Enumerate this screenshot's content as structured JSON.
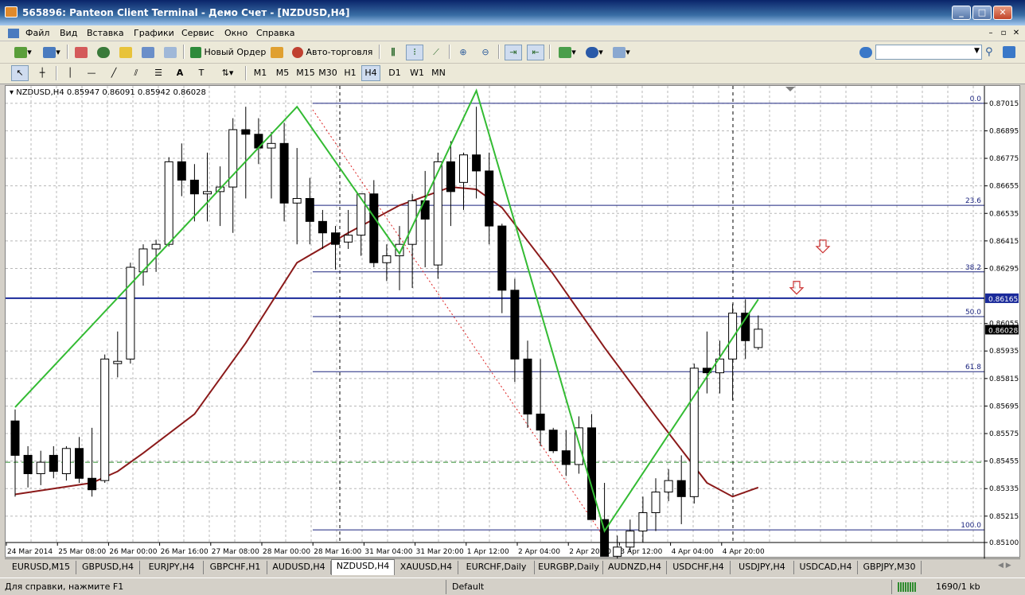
{
  "window": {
    "title": "565896: Panteon Client Terminal - Демо Счет - [NZDUSD,H4]"
  },
  "menu": [
    "Файл",
    "Вид",
    "Вставка",
    "Графики",
    "Сервис",
    "Окно",
    "Справка"
  ],
  "toolbar": {
    "new_order": "Новый Ордер",
    "autotrade": "Авто-торговля"
  },
  "timeframes": [
    "M1",
    "M5",
    "M15",
    "M30",
    "H1",
    "H4",
    "D1",
    "W1",
    "MN"
  ],
  "active_timeframe": "H4",
  "chart": {
    "symbol_info": "NZDUSD,H4  0.85947 0.86091 0.85942 0.86028",
    "price_labels": [
      "0.87015",
      "0.86895",
      "0.86775",
      "0.86655",
      "0.86535",
      "0.86415",
      "0.86295",
      "0.86055",
      "0.85935",
      "0.85815",
      "0.85695",
      "0.85575",
      "0.85455",
      "0.85335",
      "0.85215",
      "0.85100"
    ],
    "current_line": "0.86165",
    "bid_price": "0.86028",
    "fib_levels": [
      {
        "label": "0.0",
        "price": 0.87015
      },
      {
        "label": "23.6",
        "price": 0.8657
      },
      {
        "label": "38.2",
        "price": 0.8628
      },
      {
        "label": "50.0",
        "price": 0.86085
      },
      {
        "label": "61.8",
        "price": 0.85845
      },
      {
        "label": "100.0",
        "price": 0.85155
      }
    ],
    "time_labels": [
      "24 Mar 2014",
      "25 Mar 08:00",
      "26 Mar 00:00",
      "26 Mar 16:00",
      "27 Mar 08:00",
      "28 Mar 00:00",
      "28 Mar 16:00",
      "31 Mar 04:00",
      "31 Mar 20:00",
      "1 Apr 12:00",
      "2 Apr 04:00",
      "2 Apr 20:00",
      "3 Apr 12:00",
      "4 Apr 04:00",
      "4 Apr 20:00"
    ],
    "colors": {
      "ma": "#8b1a1a",
      "zigzag": "#33bb33",
      "levels": "#1a237e",
      "arrow": "#cc3333"
    }
  },
  "chart_data": {
    "type": "candlestick",
    "ylim": [
      0.851,
      0.8707
    ],
    "candles": [
      {
        "o": 0.8563,
        "h": 0.8568,
        "l": 0.853,
        "c": 0.8548
      },
      {
        "o": 0.8548,
        "h": 0.8552,
        "l": 0.8534,
        "c": 0.854
      },
      {
        "o": 0.854,
        "h": 0.855,
        "l": 0.8535,
        "c": 0.8545
      },
      {
        "o": 0.8548,
        "h": 0.8552,
        "l": 0.8538,
        "c": 0.8541
      },
      {
        "o": 0.854,
        "h": 0.8552,
        "l": 0.8537,
        "c": 0.8551
      },
      {
        "o": 0.8551,
        "h": 0.8556,
        "l": 0.8536,
        "c": 0.8538
      },
      {
        "o": 0.8538,
        "h": 0.856,
        "l": 0.853,
        "c": 0.8533
      },
      {
        "o": 0.8537,
        "h": 0.8592,
        "l": 0.8536,
        "c": 0.859
      },
      {
        "o": 0.8588,
        "h": 0.8602,
        "l": 0.8582,
        "c": 0.8589
      },
      {
        "o": 0.859,
        "h": 0.8632,
        "l": 0.8588,
        "c": 0.863
      },
      {
        "o": 0.8628,
        "h": 0.864,
        "l": 0.8622,
        "c": 0.8638
      },
      {
        "o": 0.8638,
        "h": 0.8642,
        "l": 0.8628,
        "c": 0.864
      },
      {
        "o": 0.864,
        "h": 0.8678,
        "l": 0.8639,
        "c": 0.8676
      },
      {
        "o": 0.8676,
        "h": 0.8684,
        "l": 0.8661,
        "c": 0.8668
      },
      {
        "o": 0.8668,
        "h": 0.8675,
        "l": 0.865,
        "c": 0.8662
      },
      {
        "o": 0.8662,
        "h": 0.868,
        "l": 0.865,
        "c": 0.8663
      },
      {
        "o": 0.8663,
        "h": 0.8674,
        "l": 0.8648,
        "c": 0.8665
      },
      {
        "o": 0.8665,
        "h": 0.8695,
        "l": 0.8645,
        "c": 0.869
      },
      {
        "o": 0.869,
        "h": 0.87,
        "l": 0.866,
        "c": 0.8688
      },
      {
        "o": 0.8688,
        "h": 0.8695,
        "l": 0.8675,
        "c": 0.8682
      },
      {
        "o": 0.8682,
        "h": 0.8689,
        "l": 0.866,
        "c": 0.8684
      },
      {
        "o": 0.8684,
        "h": 0.8693,
        "l": 0.865,
        "c": 0.8658
      },
      {
        "o": 0.8658,
        "h": 0.8682,
        "l": 0.864,
        "c": 0.866
      },
      {
        "o": 0.866,
        "h": 0.8669,
        "l": 0.864,
        "c": 0.865
      },
      {
        "o": 0.865,
        "h": 0.8655,
        "l": 0.8638,
        "c": 0.8645
      },
      {
        "o": 0.8645,
        "h": 0.8648,
        "l": 0.8629,
        "c": 0.864
      },
      {
        "o": 0.8641,
        "h": 0.8655,
        "l": 0.8638,
        "c": 0.8644
      },
      {
        "o": 0.8644,
        "h": 0.866,
        "l": 0.8635,
        "c": 0.8662
      },
      {
        "o": 0.8662,
        "h": 0.8668,
        "l": 0.863,
        "c": 0.8632
      },
      {
        "o": 0.8632,
        "h": 0.864,
        "l": 0.8624,
        "c": 0.8635
      },
      {
        "o": 0.8635,
        "h": 0.8648,
        "l": 0.862,
        "c": 0.864
      },
      {
        "o": 0.864,
        "h": 0.8662,
        "l": 0.8621,
        "c": 0.8659
      },
      {
        "o": 0.8659,
        "h": 0.8672,
        "l": 0.863,
        "c": 0.8651
      },
      {
        "o": 0.8631,
        "h": 0.868,
        "l": 0.8625,
        "c": 0.8676
      },
      {
        "o": 0.8676,
        "h": 0.8685,
        "l": 0.8648,
        "c": 0.8663
      },
      {
        "o": 0.8667,
        "h": 0.868,
        "l": 0.8655,
        "c": 0.8679
      },
      {
        "o": 0.8679,
        "h": 0.87,
        "l": 0.866,
        "c": 0.8672
      },
      {
        "o": 0.8672,
        "h": 0.868,
        "l": 0.864,
        "c": 0.8648
      },
      {
        "o": 0.8648,
        "h": 0.8649,
        "l": 0.861,
        "c": 0.862
      },
      {
        "o": 0.862,
        "h": 0.8625,
        "l": 0.858,
        "c": 0.859
      },
      {
        "o": 0.859,
        "h": 0.8598,
        "l": 0.856,
        "c": 0.8566
      },
      {
        "o": 0.8566,
        "h": 0.859,
        "l": 0.8552,
        "c": 0.8559
      },
      {
        "o": 0.8559,
        "h": 0.856,
        "l": 0.8549,
        "c": 0.855
      },
      {
        "o": 0.855,
        "h": 0.8559,
        "l": 0.8539,
        "c": 0.8544
      },
      {
        "o": 0.8544,
        "h": 0.8565,
        "l": 0.854,
        "c": 0.856
      },
      {
        "o": 0.856,
        "h": 0.8566,
        "l": 0.852,
        "c": 0.852
      },
      {
        "o": 0.852,
        "h": 0.8536,
        "l": 0.8508,
        "c": 0.8504
      },
      {
        "o": 0.8504,
        "h": 0.8513,
        "l": 0.85,
        "c": 0.8508
      },
      {
        "o": 0.8508,
        "h": 0.852,
        "l": 0.8506,
        "c": 0.8515
      },
      {
        "o": 0.8515,
        "h": 0.853,
        "l": 0.851,
        "c": 0.8523
      },
      {
        "o": 0.8523,
        "h": 0.8538,
        "l": 0.8515,
        "c": 0.8532
      },
      {
        "o": 0.8532,
        "h": 0.8542,
        "l": 0.8528,
        "c": 0.8537
      },
      {
        "o": 0.8537,
        "h": 0.8548,
        "l": 0.8518,
        "c": 0.853
      },
      {
        "o": 0.853,
        "h": 0.8588,
        "l": 0.8527,
        "c": 0.8586
      },
      {
        "o": 0.8586,
        "h": 0.8602,
        "l": 0.8575,
        "c": 0.8584
      },
      {
        "o": 0.8584,
        "h": 0.8598,
        "l": 0.8575,
        "c": 0.859
      },
      {
        "o": 0.859,
        "h": 0.8614,
        "l": 0.8572,
        "c": 0.861
      },
      {
        "o": 0.861,
        "h": 0.8616,
        "l": 0.859,
        "c": 0.8598
      },
      {
        "o": 0.8595,
        "h": 0.8609,
        "l": 0.8594,
        "c": 0.8603
      }
    ],
    "zigzag": [
      [
        0,
        0.8569
      ],
      [
        22,
        0.87
      ],
      [
        30,
        0.8636
      ],
      [
        36,
        0.8707
      ],
      [
        46,
        0.8515
      ],
      [
        58,
        0.8616
      ]
    ],
    "ma": [
      [
        0,
        0.8531
      ],
      [
        6,
        0.8536
      ],
      [
        8,
        0.8541
      ],
      [
        10,
        0.8549
      ],
      [
        14,
        0.8566
      ],
      [
        18,
        0.8597
      ],
      [
        22,
        0.8632
      ],
      [
        26,
        0.8645
      ],
      [
        30,
        0.8657
      ],
      [
        34,
        0.8665
      ],
      [
        36,
        0.8664
      ],
      [
        38,
        0.8656
      ],
      [
        42,
        0.8627
      ],
      [
        46,
        0.8595
      ],
      [
        50,
        0.8565
      ],
      [
        54,
        0.8536
      ],
      [
        56,
        0.853
      ],
      [
        58,
        0.8534
      ]
    ]
  },
  "tabs": [
    "EURUSD,M15",
    "GBPUSD,H4",
    "EURJPY,H4",
    "GBPCHF,H1",
    "AUDUSD,H4",
    "NZDUSD,H4",
    "XAUUSD,H4",
    "EURCHF,Daily",
    "EURGBP,Daily",
    "AUDNZD,H4",
    "USDCHF,H4",
    "USDJPY,H4",
    "USDCAD,H4",
    "GBPJPY,M30"
  ],
  "active_tab": "NZDUSD,H4",
  "status": {
    "help": "Для справки, нажмите F1",
    "profile": "Default",
    "traffic": "1690/1 kb"
  }
}
